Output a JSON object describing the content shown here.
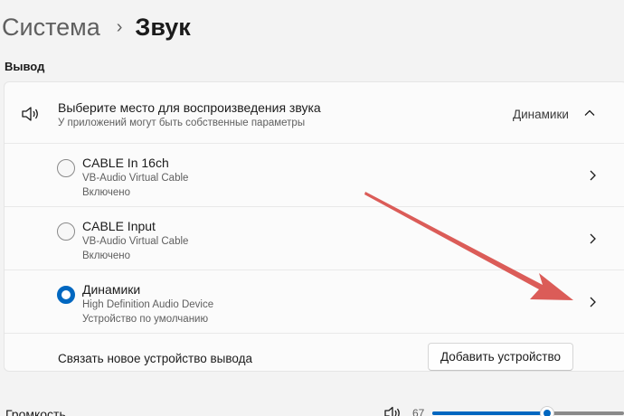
{
  "breadcrumb": {
    "parent": "Система",
    "separator": "›",
    "current": "Звук"
  },
  "output": {
    "section_label": "Вывод",
    "header": {
      "title": "Выберите место для воспроизведения звука",
      "subtitle": "У приложений могут быть собственные параметры",
      "value": "Динамики",
      "icon": "speaker-icon",
      "chevron_icon": "chevron-up-icon"
    },
    "devices": [
      {
        "name": "CABLE In 16ch",
        "description": "VB-Audio Virtual Cable",
        "status": "Включено",
        "selected": false
      },
      {
        "name": "CABLE Input",
        "description": "VB-Audio Virtual Cable",
        "status": "Включено",
        "selected": false
      },
      {
        "name": "Динамики",
        "description": "High Definition Audio Device",
        "status": "Устройство по умолчанию",
        "selected": true
      }
    ],
    "add_device": {
      "label": "Связать новое устройство вывода",
      "button": "Добавить устройство"
    }
  },
  "volume": {
    "label": "Громкость",
    "value": 67,
    "icon": "speaker-icon"
  },
  "colors": {
    "accent": "#0067c0",
    "annotation_arrow": "#d9534f"
  }
}
